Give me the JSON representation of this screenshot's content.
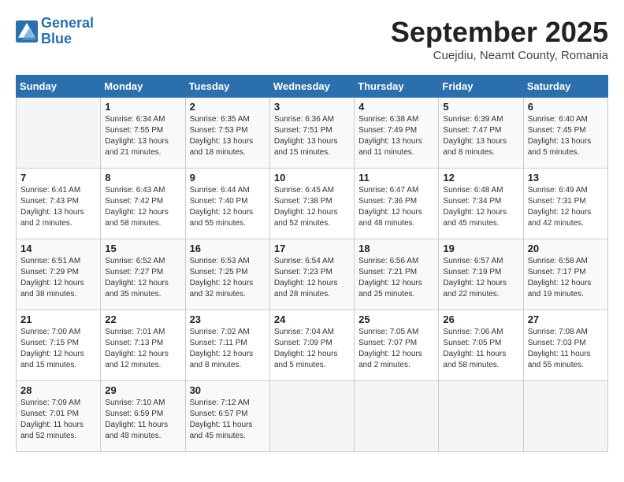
{
  "header": {
    "logo_line1": "General",
    "logo_line2": "Blue",
    "month_title": "September 2025",
    "location": "Cuejdiu, Neamt County, Romania"
  },
  "days_of_week": [
    "Sunday",
    "Monday",
    "Tuesday",
    "Wednesday",
    "Thursday",
    "Friday",
    "Saturday"
  ],
  "weeks": [
    [
      {
        "day": "",
        "info": ""
      },
      {
        "day": "1",
        "info": "Sunrise: 6:34 AM\nSunset: 7:55 PM\nDaylight: 13 hours\nand 21 minutes."
      },
      {
        "day": "2",
        "info": "Sunrise: 6:35 AM\nSunset: 7:53 PM\nDaylight: 13 hours\nand 18 minutes."
      },
      {
        "day": "3",
        "info": "Sunrise: 6:36 AM\nSunset: 7:51 PM\nDaylight: 13 hours\nand 15 minutes."
      },
      {
        "day": "4",
        "info": "Sunrise: 6:38 AM\nSunset: 7:49 PM\nDaylight: 13 hours\nand 11 minutes."
      },
      {
        "day": "5",
        "info": "Sunrise: 6:39 AM\nSunset: 7:47 PM\nDaylight: 13 hours\nand 8 minutes."
      },
      {
        "day": "6",
        "info": "Sunrise: 6:40 AM\nSunset: 7:45 PM\nDaylight: 13 hours\nand 5 minutes."
      }
    ],
    [
      {
        "day": "7",
        "info": "Sunrise: 6:41 AM\nSunset: 7:43 PM\nDaylight: 13 hours\nand 2 minutes."
      },
      {
        "day": "8",
        "info": "Sunrise: 6:43 AM\nSunset: 7:42 PM\nDaylight: 12 hours\nand 58 minutes."
      },
      {
        "day": "9",
        "info": "Sunrise: 6:44 AM\nSunset: 7:40 PM\nDaylight: 12 hours\nand 55 minutes."
      },
      {
        "day": "10",
        "info": "Sunrise: 6:45 AM\nSunset: 7:38 PM\nDaylight: 12 hours\nand 52 minutes."
      },
      {
        "day": "11",
        "info": "Sunrise: 6:47 AM\nSunset: 7:36 PM\nDaylight: 12 hours\nand 48 minutes."
      },
      {
        "day": "12",
        "info": "Sunrise: 6:48 AM\nSunset: 7:34 PM\nDaylight: 12 hours\nand 45 minutes."
      },
      {
        "day": "13",
        "info": "Sunrise: 6:49 AM\nSunset: 7:31 PM\nDaylight: 12 hours\nand 42 minutes."
      }
    ],
    [
      {
        "day": "14",
        "info": "Sunrise: 6:51 AM\nSunset: 7:29 PM\nDaylight: 12 hours\nand 38 minutes."
      },
      {
        "day": "15",
        "info": "Sunrise: 6:52 AM\nSunset: 7:27 PM\nDaylight: 12 hours\nand 35 minutes."
      },
      {
        "day": "16",
        "info": "Sunrise: 6:53 AM\nSunset: 7:25 PM\nDaylight: 12 hours\nand 32 minutes."
      },
      {
        "day": "17",
        "info": "Sunrise: 6:54 AM\nSunset: 7:23 PM\nDaylight: 12 hours\nand 28 minutes."
      },
      {
        "day": "18",
        "info": "Sunrise: 6:56 AM\nSunset: 7:21 PM\nDaylight: 12 hours\nand 25 minutes."
      },
      {
        "day": "19",
        "info": "Sunrise: 6:57 AM\nSunset: 7:19 PM\nDaylight: 12 hours\nand 22 minutes."
      },
      {
        "day": "20",
        "info": "Sunrise: 6:58 AM\nSunset: 7:17 PM\nDaylight: 12 hours\nand 19 minutes."
      }
    ],
    [
      {
        "day": "21",
        "info": "Sunrise: 7:00 AM\nSunset: 7:15 PM\nDaylight: 12 hours\nand 15 minutes."
      },
      {
        "day": "22",
        "info": "Sunrise: 7:01 AM\nSunset: 7:13 PM\nDaylight: 12 hours\nand 12 minutes."
      },
      {
        "day": "23",
        "info": "Sunrise: 7:02 AM\nSunset: 7:11 PM\nDaylight: 12 hours\nand 8 minutes."
      },
      {
        "day": "24",
        "info": "Sunrise: 7:04 AM\nSunset: 7:09 PM\nDaylight: 12 hours\nand 5 minutes."
      },
      {
        "day": "25",
        "info": "Sunrise: 7:05 AM\nSunset: 7:07 PM\nDaylight: 12 hours\nand 2 minutes."
      },
      {
        "day": "26",
        "info": "Sunrise: 7:06 AM\nSunset: 7:05 PM\nDaylight: 11 hours\nand 58 minutes."
      },
      {
        "day": "27",
        "info": "Sunrise: 7:08 AM\nSunset: 7:03 PM\nDaylight: 11 hours\nand 55 minutes."
      }
    ],
    [
      {
        "day": "28",
        "info": "Sunrise: 7:09 AM\nSunset: 7:01 PM\nDaylight: 11 hours\nand 52 minutes."
      },
      {
        "day": "29",
        "info": "Sunrise: 7:10 AM\nSunset: 6:59 PM\nDaylight: 11 hours\nand 48 minutes."
      },
      {
        "day": "30",
        "info": "Sunrise: 7:12 AM\nSunset: 6:57 PM\nDaylight: 11 hours\nand 45 minutes."
      },
      {
        "day": "",
        "info": ""
      },
      {
        "day": "",
        "info": ""
      },
      {
        "day": "",
        "info": ""
      },
      {
        "day": "",
        "info": ""
      }
    ]
  ]
}
